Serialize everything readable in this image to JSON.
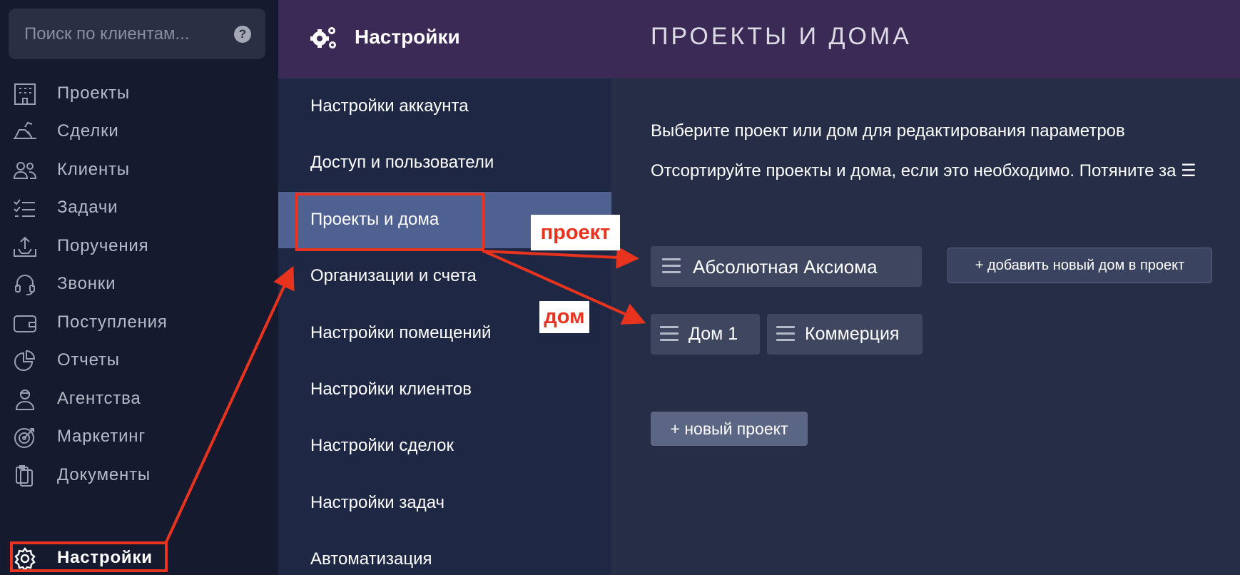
{
  "sidebar": {
    "search_placeholder": "Поиск по клиентам...",
    "help_glyph": "?",
    "items": [
      {
        "label": "Проекты",
        "icon": "building-icon"
      },
      {
        "label": "Сделки",
        "icon": "handshake-icon"
      },
      {
        "label": "Клиенты",
        "icon": "users-icon"
      },
      {
        "label": "Задачи",
        "icon": "checklist-icon"
      },
      {
        "label": "Поручения",
        "icon": "upload-tray-icon"
      },
      {
        "label": "Звонки",
        "icon": "headset-icon"
      },
      {
        "label": "Поступления",
        "icon": "wallet-icon"
      },
      {
        "label": "Отчеты",
        "icon": "pie-chart-icon"
      },
      {
        "label": "Агентства",
        "icon": "agent-icon"
      },
      {
        "label": "Маркетинг",
        "icon": "target-icon"
      },
      {
        "label": "Документы",
        "icon": "documents-icon"
      },
      {
        "label": "Настройки",
        "icon": "gear-icon",
        "active": true
      }
    ]
  },
  "settings": {
    "title": "Настройки",
    "menu": [
      {
        "label": "Настройки аккаунта"
      },
      {
        "label": "Доступ и пользователи"
      },
      {
        "label": "Проекты и дома",
        "active": true
      },
      {
        "label": "Организации и счета"
      },
      {
        "label": "Настройки помещений"
      },
      {
        "label": "Настройки клиентов"
      },
      {
        "label": "Настройки сделок"
      },
      {
        "label": "Настройки задач"
      },
      {
        "label": "Автоматизация"
      }
    ]
  },
  "main": {
    "title": "ПРОЕКТЫ И ДОМА",
    "intro_1": "Выберите проект или дом для редактирования параметров",
    "intro_2": "Отсортируйте проекты и дома, если это необходимо. Потяните за ☰",
    "project_name": "Абсолютная Аксиома",
    "add_house_label": "+ добавить новый дом в проект",
    "houses": [
      "Дом 1",
      "Коммерция"
    ],
    "new_project_label": "+ новый проект"
  },
  "annotations": {
    "project_tag": "проект",
    "house_tag": "дом",
    "accent_color": "#e8331f"
  },
  "colors": {
    "sidebar_bg": "#161a2f",
    "header_bg": "#3b2a55",
    "menu_bg": "#1e2844",
    "active_menu_bg": "#4f6191",
    "main_bg": "#252d47"
  }
}
